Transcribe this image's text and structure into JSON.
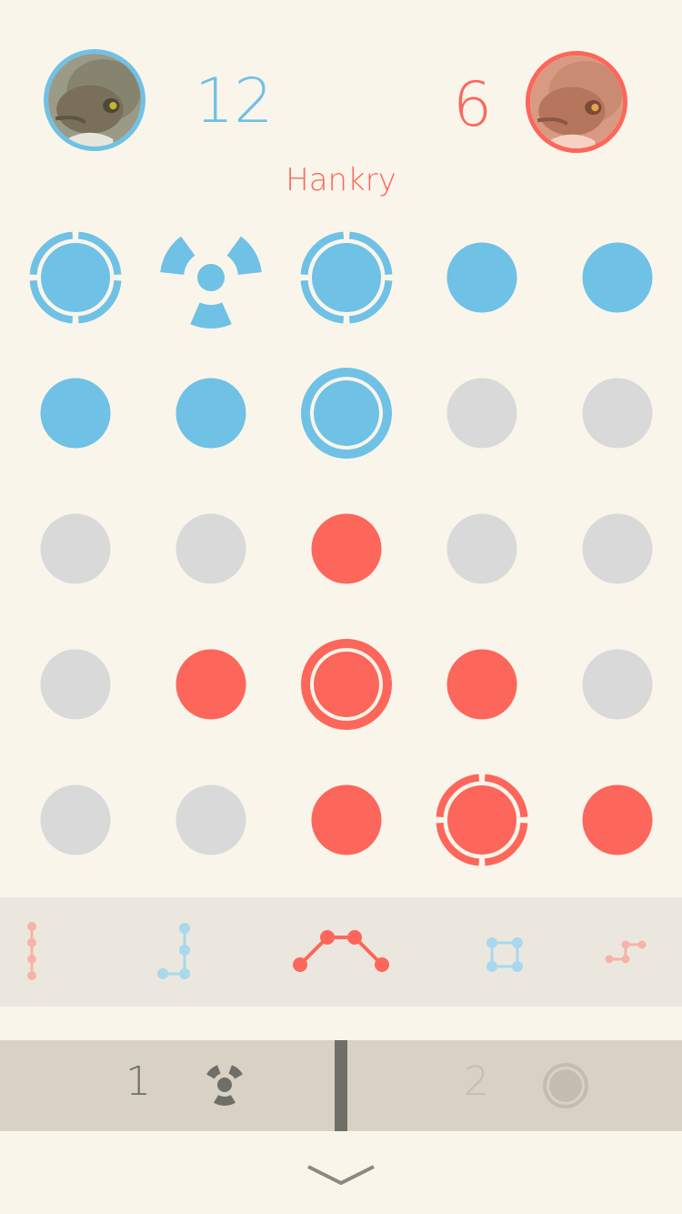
{
  "players": [
    {
      "side": "left",
      "score": "12",
      "color": "#6fc1e6"
    },
    {
      "side": "right",
      "score": "6",
      "color": "#fd665a"
    }
  ],
  "turn_player_name": "Hankry",
  "colors": {
    "blue": "#6fc1e6",
    "red": "#fd665a",
    "empty": "#d9d9d9",
    "background": "#faf5ea",
    "blue_light": "#a8d8ee",
    "red_light": "#f6b3a8"
  },
  "board": [
    [
      {
        "c": "blue",
        "s": "shield"
      },
      {
        "c": "blue",
        "s": "bomb"
      },
      {
        "c": "blue",
        "s": "shield"
      },
      {
        "c": "blue",
        "s": "plain"
      },
      {
        "c": "blue",
        "s": "plain"
      }
    ],
    [
      {
        "c": "blue",
        "s": "plain"
      },
      {
        "c": "blue",
        "s": "plain"
      },
      {
        "c": "blue",
        "s": "ring"
      },
      {
        "c": "empty",
        "s": "plain"
      },
      {
        "c": "empty",
        "s": "plain"
      }
    ],
    [
      {
        "c": "empty",
        "s": "plain"
      },
      {
        "c": "empty",
        "s": "plain"
      },
      {
        "c": "red",
        "s": "plain"
      },
      {
        "c": "empty",
        "s": "plain"
      },
      {
        "c": "empty",
        "s": "plain"
      }
    ],
    [
      {
        "c": "empty",
        "s": "plain"
      },
      {
        "c": "red",
        "s": "plain"
      },
      {
        "c": "red",
        "s": "ring"
      },
      {
        "c": "red",
        "s": "plain"
      },
      {
        "c": "empty",
        "s": "plain"
      }
    ],
    [
      {
        "c": "empty",
        "s": "plain"
      },
      {
        "c": "empty",
        "s": "plain"
      },
      {
        "c": "red",
        "s": "plain"
      },
      {
        "c": "red",
        "s": "shield"
      },
      {
        "c": "red",
        "s": "plain"
      }
    ]
  ],
  "move_patterns": [
    {
      "name": "vertical-line-pattern",
      "color": "red_light"
    },
    {
      "name": "l-shape-pattern",
      "color": "blue_light"
    },
    {
      "name": "arch-pattern",
      "color": "red",
      "selected": true
    },
    {
      "name": "square-pattern",
      "color": "blue_light"
    },
    {
      "name": "step-pattern",
      "color": "red_light"
    }
  ],
  "powerups": [
    {
      "count": "1",
      "icon": "bomb-icon",
      "active": true
    },
    {
      "count": "2",
      "icon": "ring-icon",
      "active": false
    }
  ]
}
